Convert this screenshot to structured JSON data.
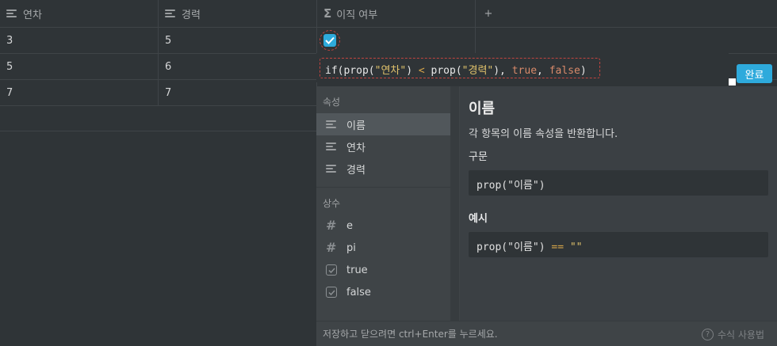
{
  "table": {
    "columns": [
      {
        "label": "연차",
        "icon": "text-lines-icon"
      },
      {
        "label": "경력",
        "icon": "text-lines-icon"
      },
      {
        "label": "이직 여부",
        "icon": "sigma-icon"
      }
    ],
    "add_column": "+",
    "rows": [
      {
        "year": "3",
        "career": "5",
        "checked": true
      },
      {
        "year": "5",
        "career": "6"
      },
      {
        "year": "7",
        "career": "7"
      }
    ]
  },
  "formula": {
    "parts": {
      "p1": "if(prop(",
      "s1": "\"연차\"",
      "p2": ") ",
      "op": "<",
      "p3": " prop(",
      "s2": "\"경력\"",
      "p4": "), ",
      "k1": "true",
      "p5": ", ",
      "k2": "false",
      "p6": ")"
    }
  },
  "done_button": "완료",
  "left_panel": {
    "properties_label": "속성",
    "properties": [
      "이름",
      "연차",
      "경력"
    ],
    "constants_label": "상수",
    "constants": [
      {
        "label": "e",
        "icon": "hash-icon"
      },
      {
        "label": "pi",
        "icon": "hash-icon"
      },
      {
        "label": "true",
        "icon": "checkbox-icon"
      },
      {
        "label": "false",
        "icon": "checkbox-icon"
      }
    ]
  },
  "doc": {
    "title": "이름",
    "description": "각 항목의 이름 속성을 반환합니다.",
    "syntax_label": "구문",
    "syntax_code": "prop(\"이름\")",
    "example_label": "예시",
    "example_code_prefix": "prop(\"이름\") ",
    "example_code_op": "==",
    "example_code_str": " \"\""
  },
  "footer": {
    "hint": "저장하고 닫으려면 ctrl+Enter를 누르세요.",
    "help": "수식 사용법",
    "help_icon": "?"
  },
  "colors": {
    "accent": "#2eaadc",
    "background": "#2f3437",
    "panel": "#3f4447",
    "focus_ring": "#c1443f"
  }
}
